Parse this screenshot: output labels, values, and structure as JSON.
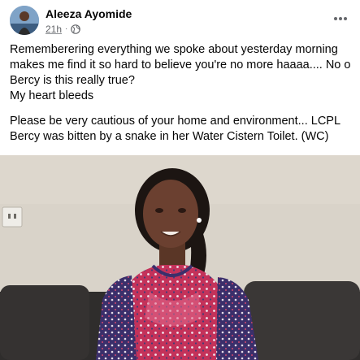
{
  "post": {
    "author_name": "Aleeza Ayomide",
    "timestamp": "21h",
    "separator": "·",
    "privacy_icon": "globe-icon",
    "more_icon": "more-options-icon",
    "paragraph_1": "Rememberering everything we spoke about yesterday morning makes me find it so hard to believe you're no more haaaa.... No o Bercy is this really true?",
    "paragraph_1b": "My heart bleeds",
    "paragraph_2": "Please be very cautious of your home and environment...  LCPL Bercy was bitten by a snake in her Water Cistern Toilet. (WC)",
    "photo_icon": "post-photo"
  },
  "colors": {
    "text_primary": "#050505",
    "text_secondary": "#65676b",
    "background": "#ffffff"
  }
}
